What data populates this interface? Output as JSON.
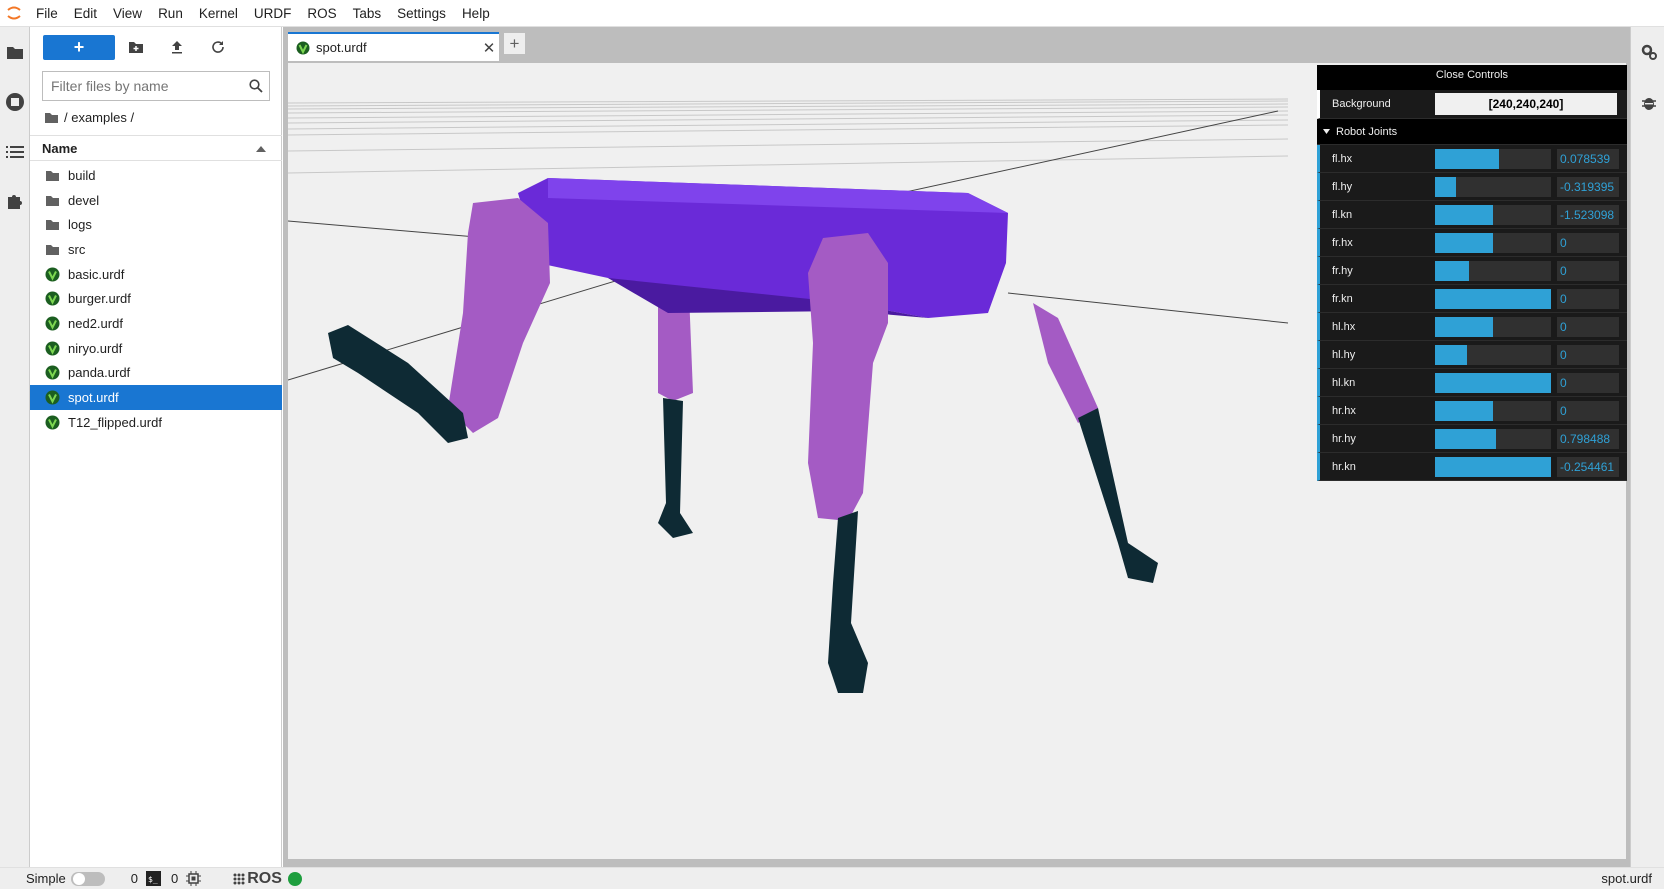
{
  "menu": [
    "File",
    "Edit",
    "View",
    "Run",
    "Kernel",
    "URDF",
    "ROS",
    "Tabs",
    "Settings",
    "Help"
  ],
  "filebrowser": {
    "new_label": "+",
    "search_placeholder": "Filter files by name",
    "breadcrumb": "/ examples /",
    "column_name": "Name",
    "items": [
      {
        "name": "build",
        "type": "folder"
      },
      {
        "name": "devel",
        "type": "folder"
      },
      {
        "name": "logs",
        "type": "folder"
      },
      {
        "name": "src",
        "type": "folder"
      },
      {
        "name": "basic.urdf",
        "type": "urdf"
      },
      {
        "name": "burger.urdf",
        "type": "urdf"
      },
      {
        "name": "ned2.urdf",
        "type": "urdf"
      },
      {
        "name": "niryo.urdf",
        "type": "urdf"
      },
      {
        "name": "panda.urdf",
        "type": "urdf"
      },
      {
        "name": "spot.urdf",
        "type": "urdf",
        "selected": true
      },
      {
        "name": "T12_flipped.urdf",
        "type": "urdf"
      }
    ]
  },
  "tab": {
    "label": "spot.urdf",
    "close": "✕",
    "add": "+"
  },
  "controls": {
    "close_label": "Close Controls",
    "background_label": "Background",
    "background_value": "[240,240,240]",
    "joints_folder": "Robot Joints",
    "joints": [
      {
        "name": "fl.hx",
        "value": "0.078539",
        "fill": 0.55
      },
      {
        "name": "fl.hy",
        "value": "-0.319395",
        "fill": 0.18
      },
      {
        "name": "fl.kn",
        "value": "-1.523098",
        "fill": 0.5
      },
      {
        "name": "fr.hx",
        "value": "0",
        "fill": 0.5
      },
      {
        "name": "fr.hy",
        "value": "0",
        "fill": 0.29
      },
      {
        "name": "fr.kn",
        "value": "0",
        "fill": 1.0
      },
      {
        "name": "hl.hx",
        "value": "0",
        "fill": 0.5
      },
      {
        "name": "hl.hy",
        "value": "0",
        "fill": 0.28
      },
      {
        "name": "hl.kn",
        "value": "0",
        "fill": 1.0
      },
      {
        "name": "hr.hx",
        "value": "0",
        "fill": 0.5
      },
      {
        "name": "hr.hy",
        "value": "0.798488",
        "fill": 0.53
      },
      {
        "name": "hr.kn",
        "value": "-0.254461",
        "fill": 1.0
      }
    ]
  },
  "status": {
    "mode_label": "Simple",
    "terminals": "0",
    "kernels": "0",
    "ros_label": "ROS",
    "ros_status_color": "#1e9e3e",
    "current_file": "spot.urdf"
  },
  "colors": {
    "accent": "#1976d2",
    "slider": "#2fa1d6",
    "robot_body": "#6a2ad8",
    "robot_legs": "#a65ac2",
    "robot_feet": "#0e2a34"
  }
}
